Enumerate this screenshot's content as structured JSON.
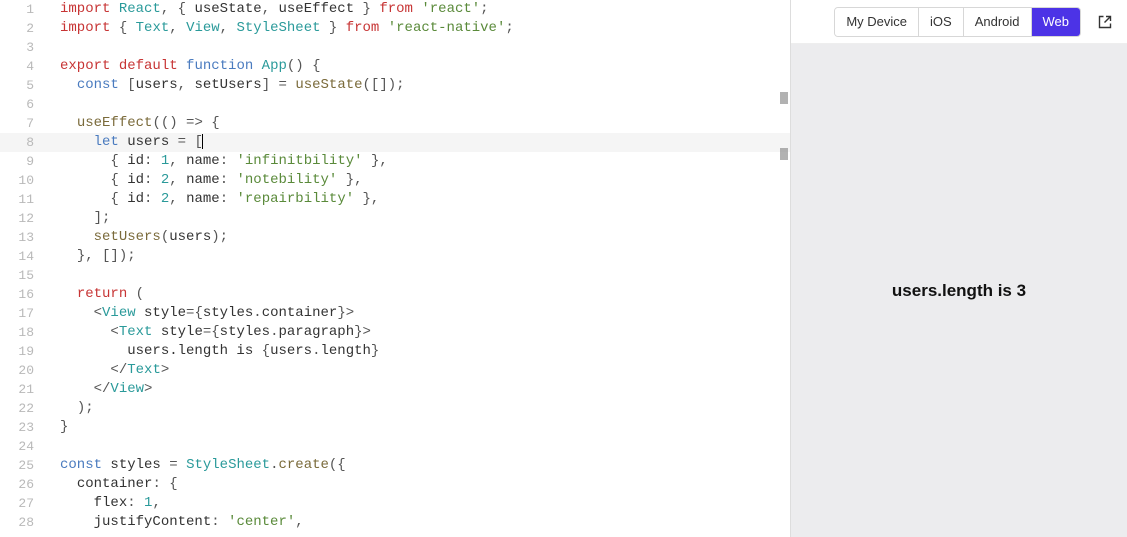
{
  "editor": {
    "highlighted_line": 8,
    "lines": [
      {
        "n": 1,
        "html": "<span class='tok-kw'>import</span> <span class='tok-type'>React</span><span class='tok-punc'>, {</span> <span class='tok-id'>useState</span><span class='tok-punc'>,</span> <span class='tok-id'>useEffect</span> <span class='tok-punc'>}</span> <span class='tok-kw'>from</span> <span class='tok-str'>'react'</span><span class='tok-punc'>;</span>"
      },
      {
        "n": 2,
        "html": "<span class='tok-kw'>import</span> <span class='tok-punc'>{</span> <span class='tok-type'>Text</span><span class='tok-punc'>,</span> <span class='tok-type'>View</span><span class='tok-punc'>,</span> <span class='tok-type'>StyleSheet</span> <span class='tok-punc'>}</span> <span class='tok-kw'>from</span> <span class='tok-str'>'react-native'</span><span class='tok-punc'>;</span>"
      },
      {
        "n": 3,
        "html": ""
      },
      {
        "n": 4,
        "html": "<span class='tok-kw'>export</span> <span class='tok-kw'>default</span> <span class='tok-kw2'>function</span> <span class='tok-type'>App</span><span class='tok-punc'>() {</span>"
      },
      {
        "n": 5,
        "html": "  <span class='tok-kw2'>const</span> <span class='tok-punc'>[</span><span class='tok-id'>users</span><span class='tok-punc'>,</span> <span class='tok-id'>setUsers</span><span class='tok-punc'>] =</span> <span class='tok-fn'>useState</span><span class='tok-punc'>([]);</span>"
      },
      {
        "n": 6,
        "html": ""
      },
      {
        "n": 7,
        "html": "  <span class='tok-fn'>useEffect</span><span class='tok-punc'>(() =&gt; {</span>"
      },
      {
        "n": 8,
        "html": "    <span class='tok-kw2'>let</span> <span class='tok-id'>users</span> <span class='tok-punc'>=</span> <span class='tok-punc'>[</span><span class='cursor'></span>"
      },
      {
        "n": 9,
        "html": "      <span class='tok-punc'>{</span> <span class='tok-id'>id</span><span class='tok-punc'>:</span> <span class='tok-num'>1</span><span class='tok-punc'>,</span> <span class='tok-id'>name</span><span class='tok-punc'>:</span> <span class='tok-str'>'infinitbility'</span> <span class='tok-punc'>},</span>"
      },
      {
        "n": 10,
        "html": "      <span class='tok-punc'>{</span> <span class='tok-id'>id</span><span class='tok-punc'>:</span> <span class='tok-num'>2</span><span class='tok-punc'>,</span> <span class='tok-id'>name</span><span class='tok-punc'>:</span> <span class='tok-str'>'notebility'</span> <span class='tok-punc'>},</span>"
      },
      {
        "n": 11,
        "html": "      <span class='tok-punc'>{</span> <span class='tok-id'>id</span><span class='tok-punc'>:</span> <span class='tok-num'>2</span><span class='tok-punc'>,</span> <span class='tok-id'>name</span><span class='tok-punc'>:</span> <span class='tok-str'>'repairbility'</span> <span class='tok-punc'>},</span>"
      },
      {
        "n": 12,
        "html": "    <span class='tok-punc'>];</span>"
      },
      {
        "n": 13,
        "html": "    <span class='tok-fn'>setUsers</span><span class='tok-punc'>(</span><span class='tok-id'>users</span><span class='tok-punc'>);</span>"
      },
      {
        "n": 14,
        "html": "  <span class='tok-punc'>}, []);</span>"
      },
      {
        "n": 15,
        "html": ""
      },
      {
        "n": 16,
        "html": "  <span class='tok-kw'>return</span> <span class='tok-punc'>(</span>"
      },
      {
        "n": 17,
        "html": "    <span class='tok-punc'>&lt;</span><span class='tok-type'>View</span> <span class='tok-id'>style</span><span class='tok-punc'>={</span><span class='tok-id'>styles</span><span class='tok-punc'>.</span><span class='tok-id'>container</span><span class='tok-punc'>}&gt;</span>"
      },
      {
        "n": 18,
        "html": "      <span class='tok-punc'>&lt;</span><span class='tok-type'>Text</span> <span class='tok-id'>style</span><span class='tok-punc'>={</span><span class='tok-id'>styles</span><span class='tok-punc'>.</span><span class='tok-id'>paragraph</span><span class='tok-punc'>}&gt;</span>"
      },
      {
        "n": 19,
        "html": "        <span class='tok-id'>users.length is</span> <span class='tok-punc'>{</span><span class='tok-id'>users</span><span class='tok-punc'>.</span><span class='tok-id'>length</span><span class='tok-punc'>}</span>"
      },
      {
        "n": 20,
        "html": "      <span class='tok-punc'>&lt;/</span><span class='tok-type'>Text</span><span class='tok-punc'>&gt;</span>"
      },
      {
        "n": 21,
        "html": "    <span class='tok-punc'>&lt;/</span><span class='tok-type'>View</span><span class='tok-punc'>&gt;</span>"
      },
      {
        "n": 22,
        "html": "  <span class='tok-punc'>);</span>"
      },
      {
        "n": 23,
        "html": "<span class='tok-punc'>}</span>"
      },
      {
        "n": 24,
        "html": ""
      },
      {
        "n": 25,
        "html": "<span class='tok-kw2'>const</span> <span class='tok-id'>styles</span> <span class='tok-punc'>=</span> <span class='tok-type'>StyleSheet</span><span class='tok-punc'>.</span><span class='tok-fn'>create</span><span class='tok-punc'>({</span>"
      },
      {
        "n": 26,
        "html": "  <span class='tok-id'>container</span><span class='tok-punc'>: {</span>"
      },
      {
        "n": 27,
        "html": "    <span class='tok-id'>flex</span><span class='tok-punc'>:</span> <span class='tok-num'>1</span><span class='tok-punc'>,</span>"
      },
      {
        "n": 28,
        "html": "    <span class='tok-id'>justifyContent</span><span class='tok-punc'>:</span> <span class='tok-str'>'center'</span><span class='tok-punc'>,</span>"
      }
    ]
  },
  "preview": {
    "tabs": {
      "my_device": "My Device",
      "ios": "iOS",
      "android": "Android",
      "web": "Web",
      "active": "web"
    },
    "output_text": "users.length is 3",
    "open_external_icon": "open-external"
  }
}
